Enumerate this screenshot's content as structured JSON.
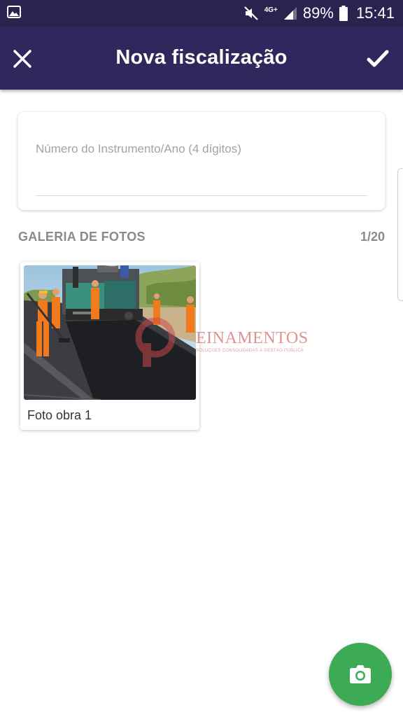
{
  "status_bar": {
    "gallery_icon": "image-icon",
    "mute_icon": "vibrate-muted-icon",
    "network_label": "4G+",
    "signal_icon": "signal-icon",
    "battery_percent": "89%",
    "battery_level": 0.89,
    "battery_icon": "battery-icon",
    "time": "15:41"
  },
  "toolbar": {
    "title": "Nova fiscalização",
    "close_icon": "close-icon",
    "confirm_icon": "check-icon",
    "background": "#30275c"
  },
  "form": {
    "instrument_placeholder": "Número do Instrumento/Ano (4 dígitos)",
    "instrument_value": ""
  },
  "gallery": {
    "title": "GALERIA DE FOTOS",
    "count": "1/20",
    "photos": [
      {
        "caption": "Foto obra 1",
        "image": "road-paving-crew-photo"
      }
    ],
    "watermark": {
      "text": "EINAMENTOS",
      "subtitle": "SOLUÇÕES CONSOLIDADAS À GESTÃO PÚBLICA"
    }
  },
  "fab": {
    "icon": "camera-icon",
    "color": "#3daa56"
  }
}
